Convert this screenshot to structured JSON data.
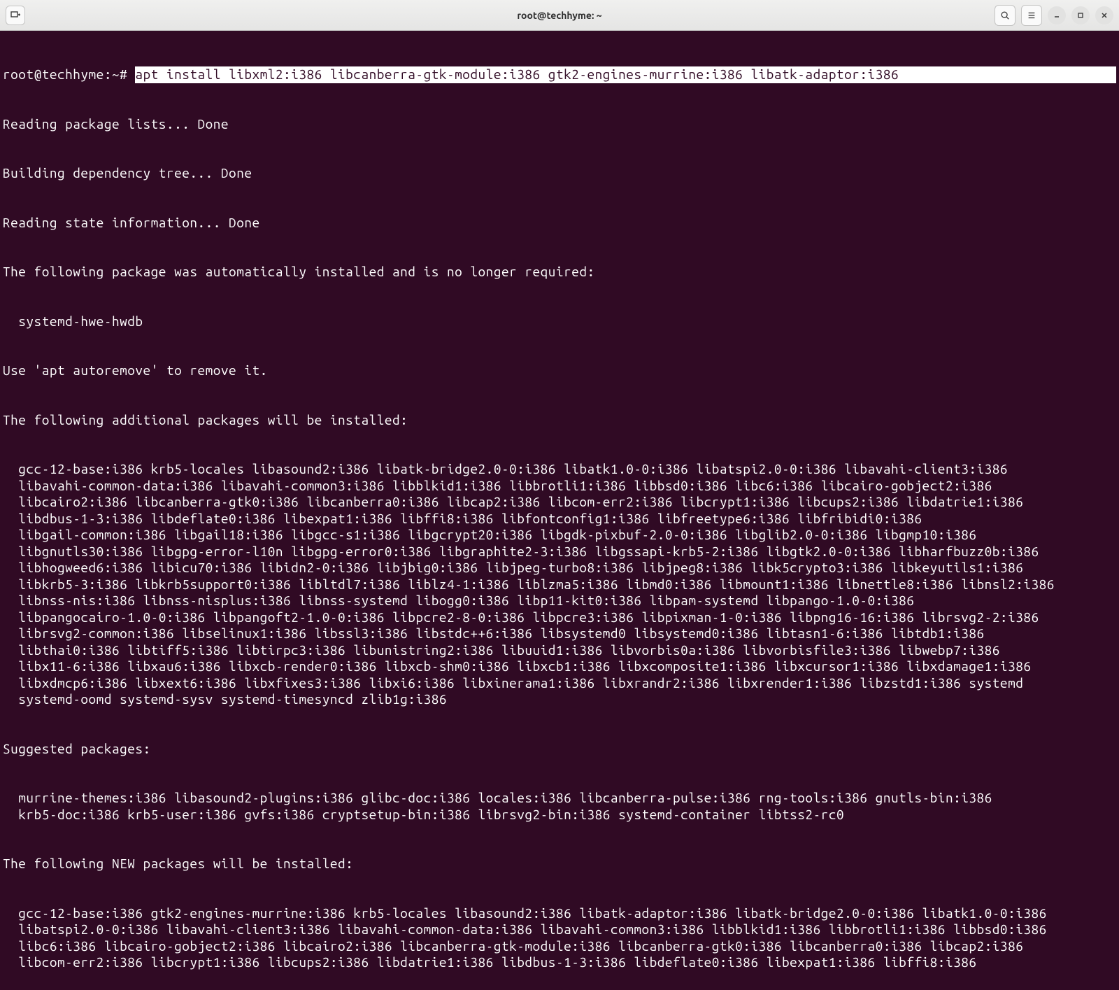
{
  "titlebar": {
    "title": "root@techhyme: ~"
  },
  "prompt": "root@techhyme:~# ",
  "command": "apt install libxml2:i386 libcanberra-gtk-module:i386 gtk2-engines-murrine:i386 libatk-adaptor:i386",
  "output": {
    "l1": "Reading package lists... Done",
    "l2": "Building dependency tree... Done",
    "l3": "Reading state information... Done",
    "l4": "The following package was automatically installed and is no longer required:",
    "l5": "  systemd-hwe-hwdb",
    "l6": "Use 'apt autoremove' to remove it.",
    "l7": "The following additional packages will be installed:",
    "additional": "  gcc-12-base:i386 krb5-locales libasound2:i386 libatk-bridge2.0-0:i386 libatk1.0-0:i386 libatspi2.0-0:i386 libavahi-client3:i386\n  libavahi-common-data:i386 libavahi-common3:i386 libblkid1:i386 libbrotli1:i386 libbsd0:i386 libc6:i386 libcairo-gobject2:i386\n  libcairo2:i386 libcanberra-gtk0:i386 libcanberra0:i386 libcap2:i386 libcom-err2:i386 libcrypt1:i386 libcups2:i386 libdatrie1:i386\n  libdbus-1-3:i386 libdeflate0:i386 libexpat1:i386 libffi8:i386 libfontconfig1:i386 libfreetype6:i386 libfribidi0:i386\n  libgail-common:i386 libgail18:i386 libgcc-s1:i386 libgcrypt20:i386 libgdk-pixbuf-2.0-0:i386 libglib2.0-0:i386 libgmp10:i386\n  libgnutls30:i386 libgpg-error-l10n libgpg-error0:i386 libgraphite2-3:i386 libgssapi-krb5-2:i386 libgtk2.0-0:i386 libharfbuzz0b:i386\n  libhogweed6:i386 libicu70:i386 libidn2-0:i386 libjbig0:i386 libjpeg-turbo8:i386 libjpeg8:i386 libk5crypto3:i386 libkeyutils1:i386\n  libkrb5-3:i386 libkrb5support0:i386 libltdl7:i386 liblz4-1:i386 liblzma5:i386 libmd0:i386 libmount1:i386 libnettle8:i386 libnsl2:i386\n  libnss-nis:i386 libnss-nisplus:i386 libnss-systemd libogg0:i386 libp11-kit0:i386 libpam-systemd libpango-1.0-0:i386\n  libpangocairo-1.0-0:i386 libpangoft2-1.0-0:i386 libpcre2-8-0:i386 libpcre3:i386 libpixman-1-0:i386 libpng16-16:i386 librsvg2-2:i386\n  librsvg2-common:i386 libselinux1:i386 libssl3:i386 libstdc++6:i386 libsystemd0 libsystemd0:i386 libtasn1-6:i386 libtdb1:i386\n  libthai0:i386 libtiff5:i386 libtirpc3:i386 libunistring2:i386 libuuid1:i386 libvorbis0a:i386 libvorbisfile3:i386 libwebp7:i386\n  libx11-6:i386 libxau6:i386 libxcb-render0:i386 libxcb-shm0:i386 libxcb1:i386 libxcomposite1:i386 libxcursor1:i386 libxdamage1:i386\n  libxdmcp6:i386 libxext6:i386 libxfixes3:i386 libxi6:i386 libxinerama1:i386 libxrandr2:i386 libxrender1:i386 libzstd1:i386 systemd\n  systemd-oomd systemd-sysv systemd-timesyncd zlib1g:i386",
    "l8": "Suggested packages:",
    "suggested": "  murrine-themes:i386 libasound2-plugins:i386 glibc-doc:i386 locales:i386 libcanberra-pulse:i386 rng-tools:i386 gnutls-bin:i386\n  krb5-doc:i386 krb5-user:i386 gvfs:i386 cryptsetup-bin:i386 librsvg2-bin:i386 systemd-container libtss2-rc0",
    "l9": "The following NEW packages will be installed:",
    "newpkg": "  gcc-12-base:i386 gtk2-engines-murrine:i386 krb5-locales libasound2:i386 libatk-adaptor:i386 libatk-bridge2.0-0:i386 libatk1.0-0:i386\n  libatspi2.0-0:i386 libavahi-client3:i386 libavahi-common-data:i386 libavahi-common3:i386 libblkid1:i386 libbrotli1:i386 libbsd0:i386\n  libc6:i386 libcairo-gobject2:i386 libcairo2:i386 libcanberra-gtk-module:i386 libcanberra-gtk0:i386 libcanberra0:i386 libcap2:i386\n  libcom-err2:i386 libcrypt1:i386 libcups2:i386 libdatrie1:i386 libdbus-1-3:i386 libdeflate0:i386 libexpat1:i386 libffi8:i386"
  }
}
